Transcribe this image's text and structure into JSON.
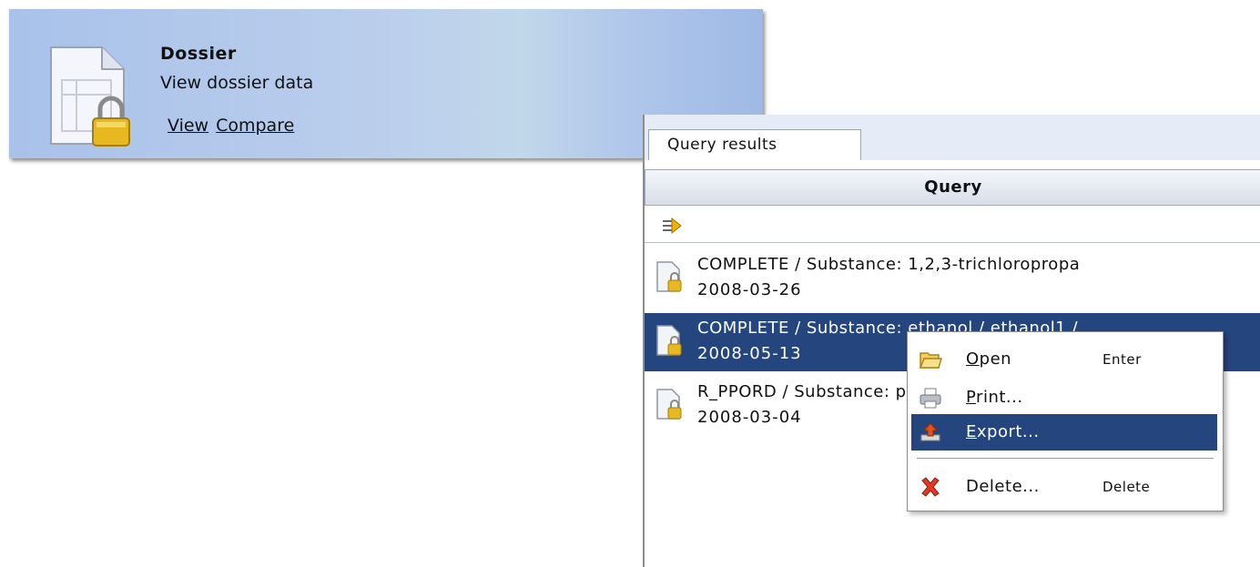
{
  "card": {
    "title": "Dossier",
    "subtitle": "View dossier data",
    "links": [
      {
        "label": "View"
      },
      {
        "label": "Compare"
      }
    ],
    "icon": "locked-document-icon"
  },
  "panel": {
    "tab_label": "Query results",
    "header": "Query",
    "toolbar_icon": "expand-arrow-icon",
    "results": [
      {
        "line1": "COMPLETE / Substance: 1,2,3-trichloropropa",
        "line2": "2008-03-26",
        "selected": false
      },
      {
        "line1": "COMPLETE / Substance: ethanol / ethanol1 /",
        "line2": "2008-05-13",
        "selected": true
      },
      {
        "line1": "R_PPORD / Substance: propan",
        "line2": "2008-03-04",
        "selected": false
      }
    ]
  },
  "context_menu": {
    "items": [
      {
        "mnemonic": "O",
        "rest": "pen",
        "accelerator": "Enter",
        "icon": "folder-open-icon"
      },
      {
        "mnemonic": "P",
        "rest": "rint...",
        "accelerator": "",
        "icon": "printer-icon"
      },
      {
        "mnemonic": "E",
        "rest": "xport...",
        "accelerator": "",
        "icon": "export-icon",
        "highlighted": true
      },
      {
        "mnemonic": "",
        "rest": "Delete...",
        "accelerator": "Delete",
        "icon": "delete-x-icon"
      }
    ]
  },
  "colors": {
    "selection": "#25457f",
    "card_gradient": "#b9cdec"
  }
}
